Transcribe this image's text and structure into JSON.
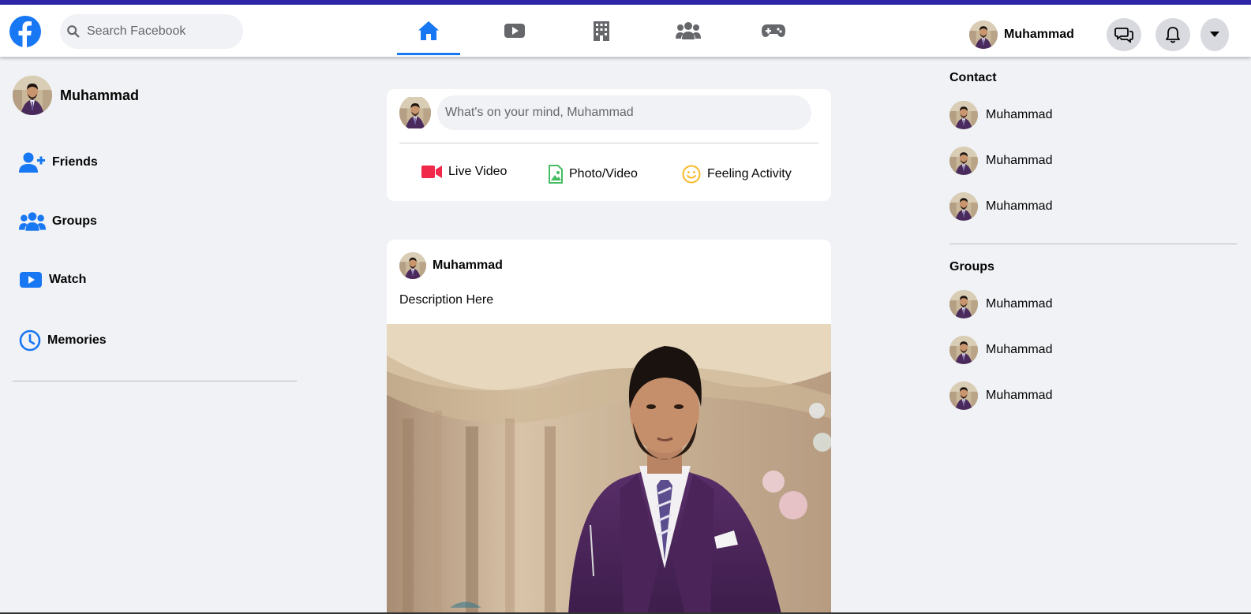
{
  "search": {
    "placeholder": "Search Facebook"
  },
  "nav": {
    "tabs": [
      {
        "name": "home",
        "active": true
      },
      {
        "name": "watch"
      },
      {
        "name": "marketplace"
      },
      {
        "name": "groups"
      },
      {
        "name": "gaming"
      }
    ],
    "user_name": "Muhammad"
  },
  "sidebar": {
    "profile_name": "Muhammad",
    "items": [
      {
        "label": "Friends",
        "icon": "add-friend-icon"
      },
      {
        "label": "Groups",
        "icon": "groups-icon"
      },
      {
        "label": "Watch",
        "icon": "watch-icon"
      },
      {
        "label": "Memories",
        "icon": "clock-icon"
      }
    ]
  },
  "composer": {
    "placeholder": "What's on your mind, Muhammad",
    "actions": [
      {
        "label": "Live Video",
        "color": "#f02849"
      },
      {
        "label": "Photo/Video",
        "color": "#45bd62"
      },
      {
        "label": "Feeling Activity",
        "color": "#f7b928"
      }
    ]
  },
  "post": {
    "author": "Muhammad",
    "description": "Description Here"
  },
  "rightbar": {
    "contact_title": "Contact",
    "contacts": [
      "Muhammad",
      "Muhammad",
      "Muhammad"
    ],
    "groups_title": "Groups",
    "groups": [
      "Muhammad",
      "Muhammad",
      "Muhammad"
    ]
  },
  "colors": {
    "brand": "#1877f2",
    "top_strip": "#2f25a8",
    "background": "#f0f2f5"
  }
}
